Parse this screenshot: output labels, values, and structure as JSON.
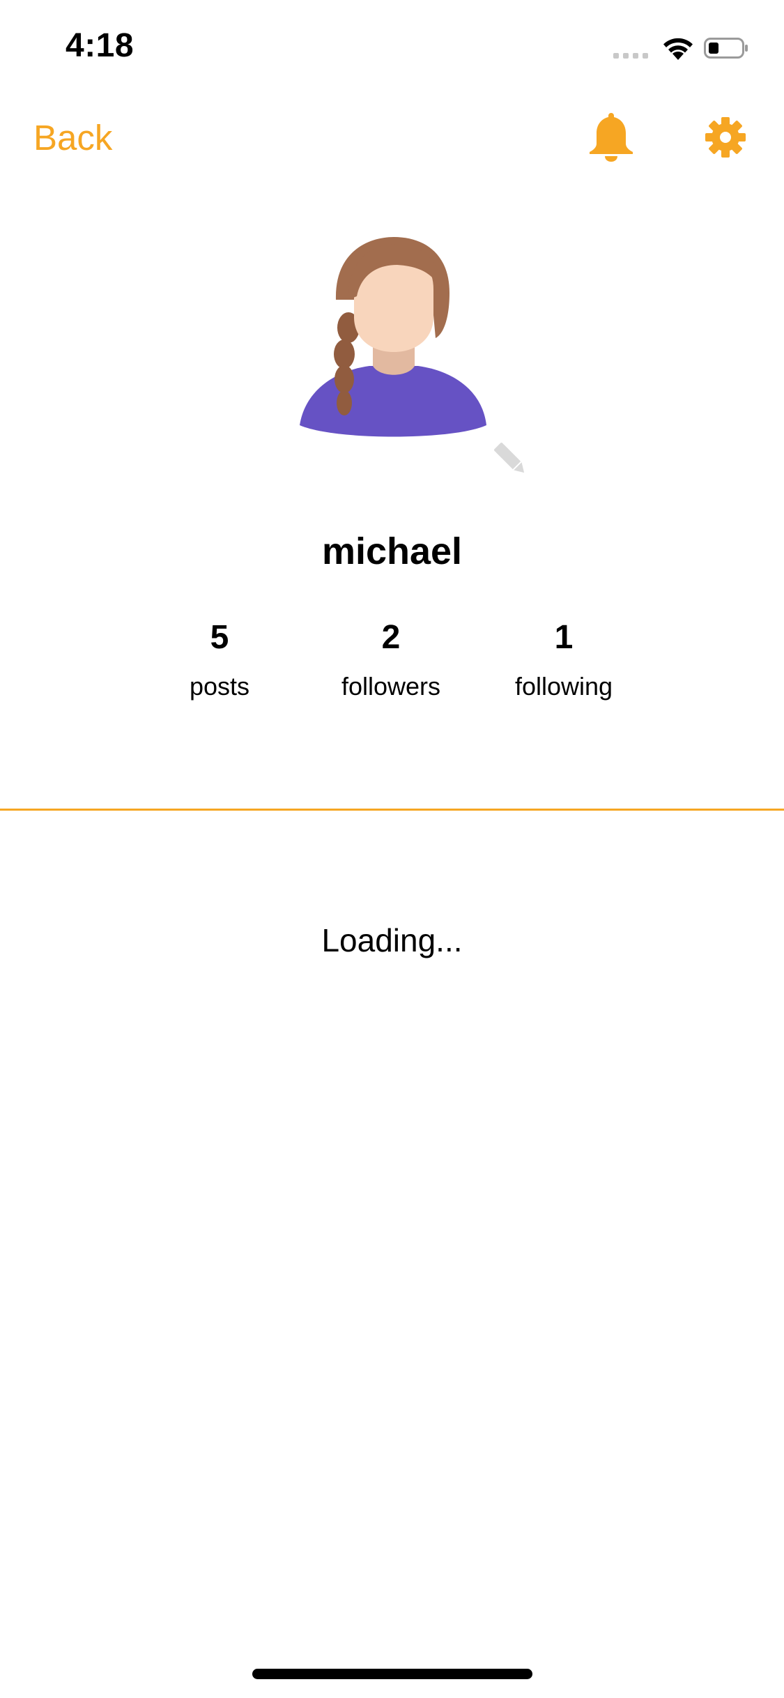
{
  "status_bar": {
    "time": "4:18"
  },
  "nav": {
    "back_label": "Back",
    "bell_icon": "bell-icon",
    "gear_icon": "gear-icon",
    "accent_color": "#f6a623"
  },
  "profile": {
    "avatar_icon": "avatar",
    "edit_icon": "pencil-icon",
    "username": "michael",
    "stats": [
      {
        "value": "5",
        "label": "posts"
      },
      {
        "value": "2",
        "label": "followers"
      },
      {
        "value": "1",
        "label": "following"
      }
    ]
  },
  "content": {
    "loading_text": "Loading..."
  }
}
